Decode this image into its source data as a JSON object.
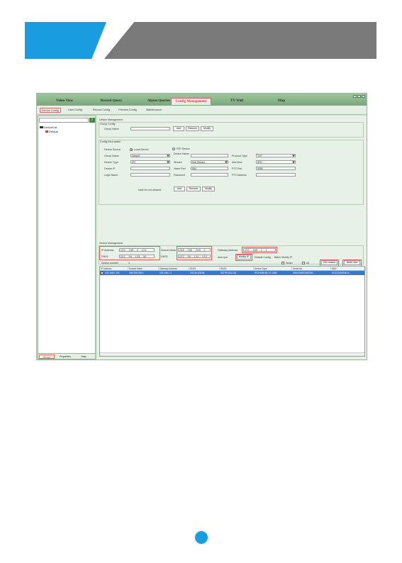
{
  "main_tabs": [
    "Video View",
    "Record Query",
    "Alarm Queries",
    "Config Management",
    "TV Wall",
    "Map"
  ],
  "sub_tabs": [
    "Device Config",
    "User Config",
    "Record Config",
    "Preview Config",
    "Maintenance"
  ],
  "left_panel": {
    "search_placeholder": "",
    "tree_root": "DeviceList",
    "tree_child": "Default",
    "bottom_tabs": [
      "Device",
      "Properties",
      "Help"
    ]
  },
  "device_management": {
    "title": "Device Management",
    "group_config_title": "Group Config",
    "group_name_label": "Group Name",
    "group_name_value": "",
    "group_buttons": [
      "Add",
      "Remove",
      "Modify"
    ],
    "config_information_title": "Config Information",
    "device_source_label": "Device Source",
    "local_device_label": "Local Device",
    "p2p_device_label": "P2P Device",
    "fields": {
      "group_name_label": "Group Name",
      "group_name_value": "Default",
      "device_name_label": "Device Name",
      "device_name_value": "",
      "protocol_type_label": "Protocol Type",
      "protocol_type_value": "TCP",
      "device_type_label": "Device Type",
      "device_type_value": "IPC",
      "stream_label": "Stream",
      "stream_value": "Sub Stream",
      "add_mode_label": "Add Mod",
      "add_mode_value": "IP/D",
      "device_ip_label": "Device IP",
      "device_ip_value": "",
      "video_port_label": "Video Port",
      "video_port_value": "554",
      "ptz_port_label": "PTZ Port",
      "ptz_port_value": "9999",
      "login_name_label": "Login Name",
      "login_name_value": "",
      "password_label": "Password",
      "password_value": "",
      "ptz_address_label": "PTZ Address",
      "ptz_address_value": ""
    },
    "note": "Note:It's not allowed",
    "config_buttons": [
      "Add",
      "Remove",
      "Modify"
    ]
  },
  "network_management": {
    "title": "Device Management",
    "ip_address_label": "IP Address",
    "ip_address": [
      "192",
      "168",
      "0",
      "123"
    ],
    "subnet_mask_label": "Subnet Mask",
    "subnet_mask": [
      "255",
      "255",
      "255",
      "0"
    ],
    "gateway_label": "Gateway Address",
    "gateway": [
      "192",
      "168",
      "1",
      "1"
    ],
    "dns1_label": "DNS1",
    "dns1": [
      "202",
      "96",
      "128",
      "86"
    ],
    "dns2_label": "DNS2",
    "dns2": [
      "202",
      "96",
      "134",
      "133"
    ],
    "auto_ip_label": "Auto ipm",
    "modify_ip_button": "Modify IP",
    "default_config_label": "Default Config",
    "batch_modify_label": "Batch Modify IP",
    "device_number_label": "Device number",
    "device_number_value": "1",
    "smart_label": "Smart",
    "all_label": "All",
    "one_search_button": "One search",
    "batch_add_button": "Batch Add"
  },
  "table": {
    "columns": [
      "IP Address",
      "Subnet Mask",
      "Gateway Address",
      "DNS1",
      "DNS2",
      "Device Type",
      "Serial No.",
      "MAC"
    ],
    "rows": [
      [
        "192.168.0.123",
        "255.255.255.0",
        "192.168.1.1",
        "202.96.128.86",
        "202.96.134.133",
        "IPC/HI3518E-V2 1080",
        "0000000000000000",
        "00:12:16:b8:6f:1c"
      ]
    ]
  }
}
